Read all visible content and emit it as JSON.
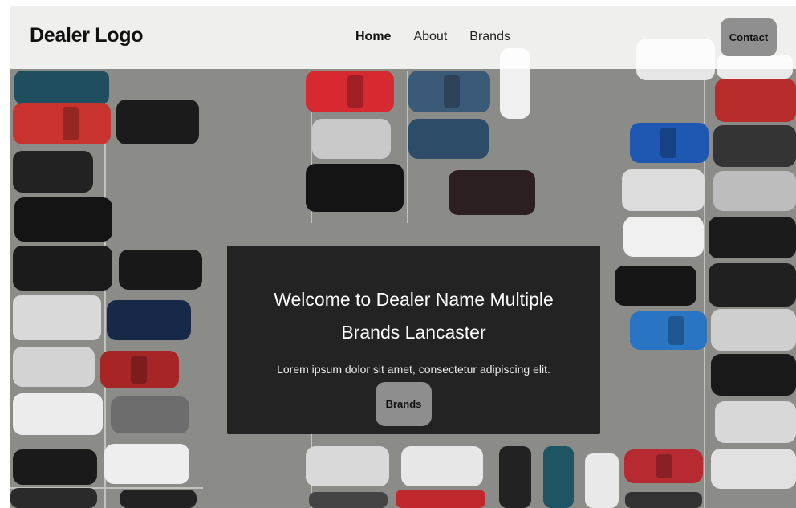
{
  "header": {
    "logo": "Dealer Logo",
    "nav": [
      {
        "label": "Home",
        "active": true
      },
      {
        "label": "About",
        "active": false
      },
      {
        "label": "Brands",
        "active": false
      }
    ],
    "contact_label": "Contact"
  },
  "hero": {
    "title": "Welcome to Dealer Name Multiple Brands Lancaster",
    "subtitle": "Lorem ipsum dolor sit amet, consectetur adipiscing elit.",
    "button_label": "Brands"
  },
  "colors": {
    "header_bg": "#ffffff",
    "hero_bg": "#141414",
    "button_bg": "#8e8e8e",
    "lot_asphalt": "#8c8c89"
  }
}
